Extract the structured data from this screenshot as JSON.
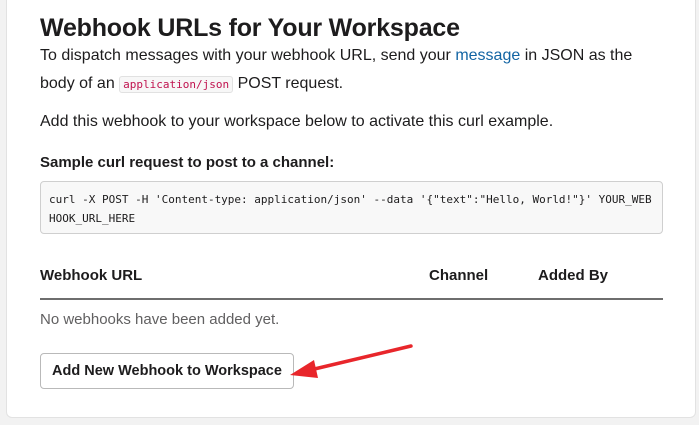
{
  "page": {
    "title": "Webhook URLs for Your Workspace",
    "intro_before_link": "To dispatch messages with your webhook URL, send your ",
    "intro_link": "message",
    "intro_after_link": " in JSON as the body of an ",
    "intro_code": "application/json",
    "intro_end": " POST request.",
    "add_note": "Add this webhook to your workspace below to activate this curl example.",
    "sample_heading": "Sample curl request to post to a channel:",
    "sample_code": "curl -X POST -H 'Content-type: application/json' --data '{\"text\":\"Hello, World!\"}' YOUR_WEBHOOK_URL_HERE"
  },
  "table": {
    "columns": [
      "Webhook URL",
      "Channel",
      "Added By"
    ],
    "empty_message": "No webhooks have been added yet."
  },
  "actions": {
    "add_button_label": "Add New Webhook to Workspace"
  },
  "annotation": {
    "arrow_color": "#e8262b"
  },
  "colors": {
    "link": "#1264a3",
    "inline_code": "#c0134f",
    "text": "#1d1c1d"
  }
}
